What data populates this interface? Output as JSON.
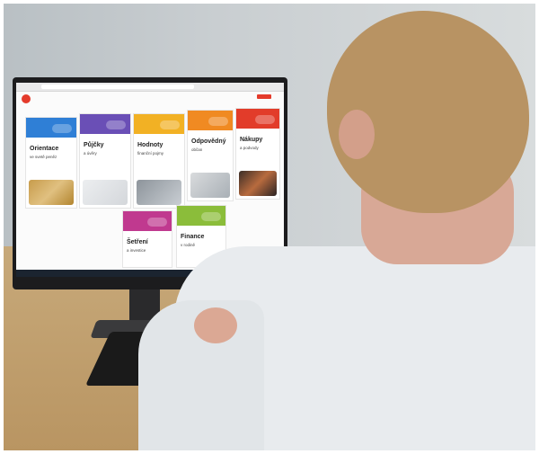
{
  "scene": {
    "description_type": "photograph",
    "colors": {
      "red": "#e43b2b",
      "blue": "#2f7fd6",
      "purple": "#6a4fb6",
      "yellow": "#f2b124",
      "orange": "#f08a22",
      "red2": "#e23c2a",
      "magenta": "#c0398f",
      "green": "#8bbd3a"
    }
  },
  "screen": {
    "logo": "",
    "cards": [
      {
        "title": "Orientace",
        "subtitle": "ve svetě peněz",
        "color": "#2f7fd6"
      },
      {
        "title": "Půjčky",
        "subtitle": "a úvěry",
        "color": "#6a4fb6"
      },
      {
        "title": "Hodnoty",
        "subtitle": "finanční pojmy",
        "color": "#f2b124"
      },
      {
        "title": "Odpovědný",
        "subtitle": "občan",
        "color": "#f08a22"
      },
      {
        "title": "Nákupy",
        "subtitle": "a podvody",
        "color": "#e23c2a"
      },
      {
        "title": "Šetření",
        "subtitle": "a investice",
        "color": "#c0398f"
      },
      {
        "title": "Finance",
        "subtitle": "v rodině",
        "color": "#8bbd3a"
      }
    ]
  }
}
